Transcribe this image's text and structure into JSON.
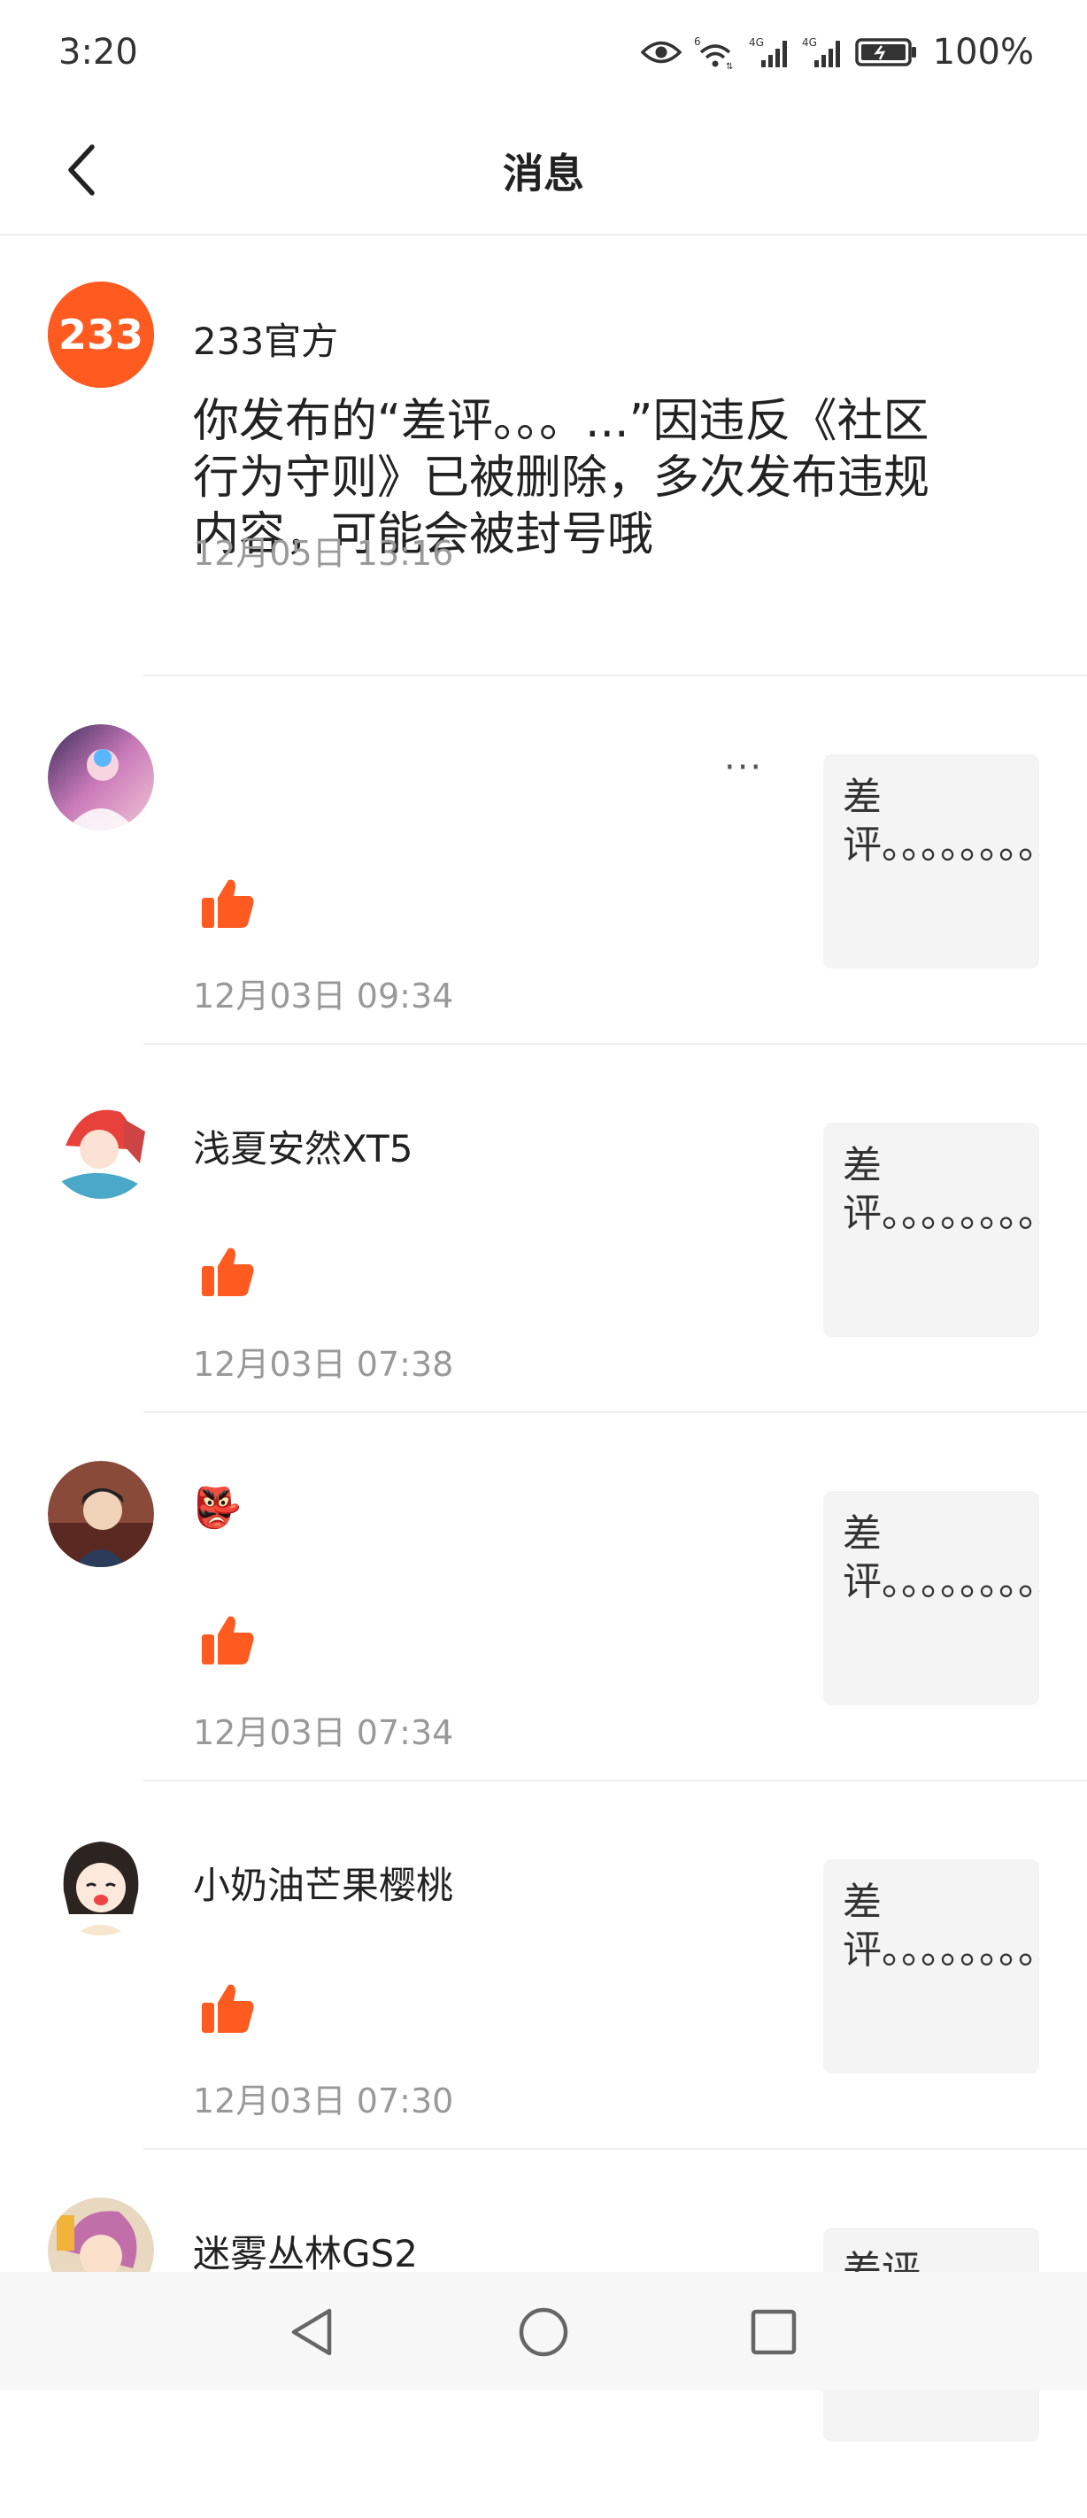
{
  "status_bar": {
    "time": "3:20",
    "battery_percent": "100%",
    "icons": [
      "eye-icon",
      "wifi-icon",
      "signal-4g-icon",
      "signal-4g-icon",
      "battery-icon"
    ]
  },
  "header": {
    "title": "消息",
    "back_icon": "chevron-left-icon"
  },
  "messages": [
    {
      "type": "official",
      "sender": "233官方",
      "avatar_text": "233",
      "content": "你发布的“差评。。。...”因违反《社区行为守则》已被删除，多次发布违规内容，可能会被封号哦",
      "time": "12月05日 13:16"
    },
    {
      "type": "like",
      "sender": "",
      "more": "···",
      "quote": "差评。。。。。。。。。…",
      "time": "12月03日 09:34"
    },
    {
      "type": "like",
      "sender": "浅夏安然XT5",
      "quote": "差评。。。。。。。。。…",
      "time": "12月03日 07:38"
    },
    {
      "type": "like",
      "sender": "👺",
      "quote": "差评。。。。。。。。。…",
      "time": "12月03日 07:34"
    },
    {
      "type": "like",
      "sender": "小奶油芒果樱桃",
      "quote": "差评。。。。。。。。。…",
      "time": "12月03日 07:30"
    },
    {
      "type": "like",
      "sender": "迷雾丛林GS2",
      "quote": "差评。。",
      "time": ""
    }
  ],
  "colors": {
    "accent": "#ff5a1f",
    "official_avatar": "#ff5a1f",
    "time_text": "#999999",
    "quote_bg": "#f4f4f4"
  },
  "nav_bar": {
    "icons": [
      "back-triangle-icon",
      "home-circle-icon",
      "recents-square-icon"
    ]
  }
}
